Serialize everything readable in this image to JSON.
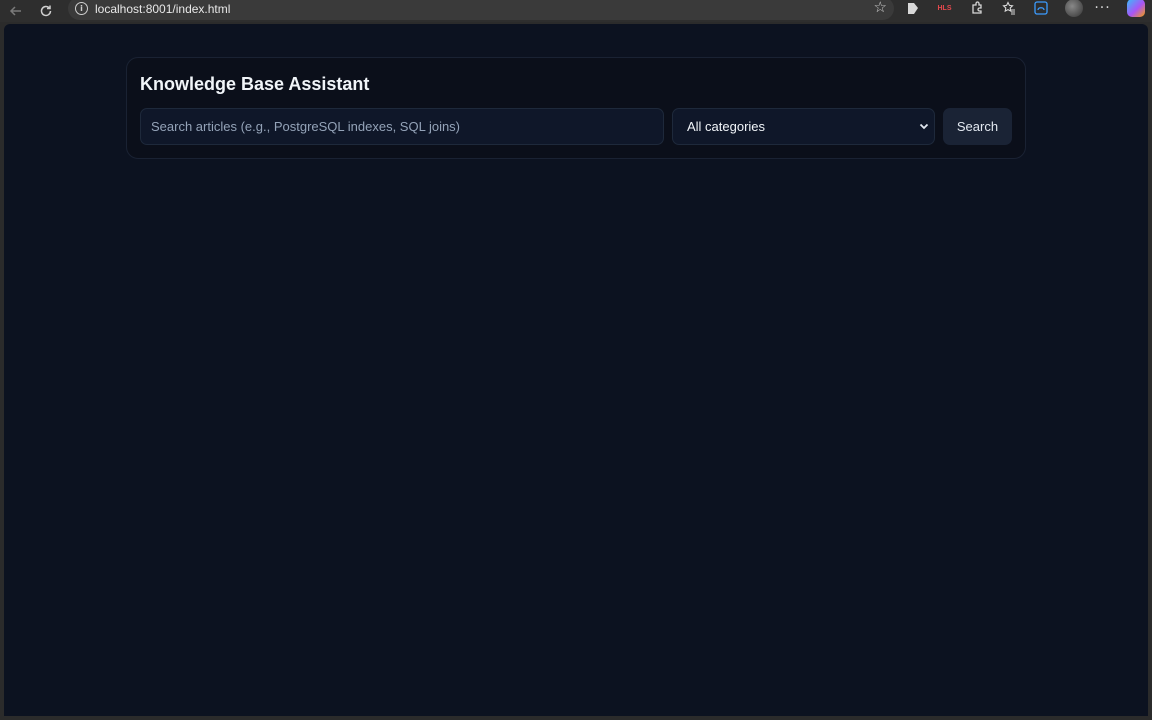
{
  "browser": {
    "url": "localhost:8001/index.html",
    "icons": [
      "back-icon",
      "reload-icon",
      "info-icon",
      "star-icon",
      "extension-icon",
      "extension-icon",
      "extension-puzzle-icon",
      "favorites-icon",
      "edge-icon",
      "profile-avatar",
      "more-icon",
      "copilot-icon"
    ],
    "ext_badge": "HLS"
  },
  "app": {
    "title": "Knowledge Base Assistant",
    "search": {
      "placeholder": "Search articles (e.g., PostgreSQL indexes, SQL joins)",
      "value": ""
    },
    "category": {
      "selected": "All categories"
    },
    "search_button_label": "Search"
  },
  "colors": {
    "page_background": "#0c1220",
    "card_background": "#0b0f1a",
    "input_background": "#0f1729",
    "button_background": "#1a2335",
    "text_primary": "#f1f5f9"
  }
}
